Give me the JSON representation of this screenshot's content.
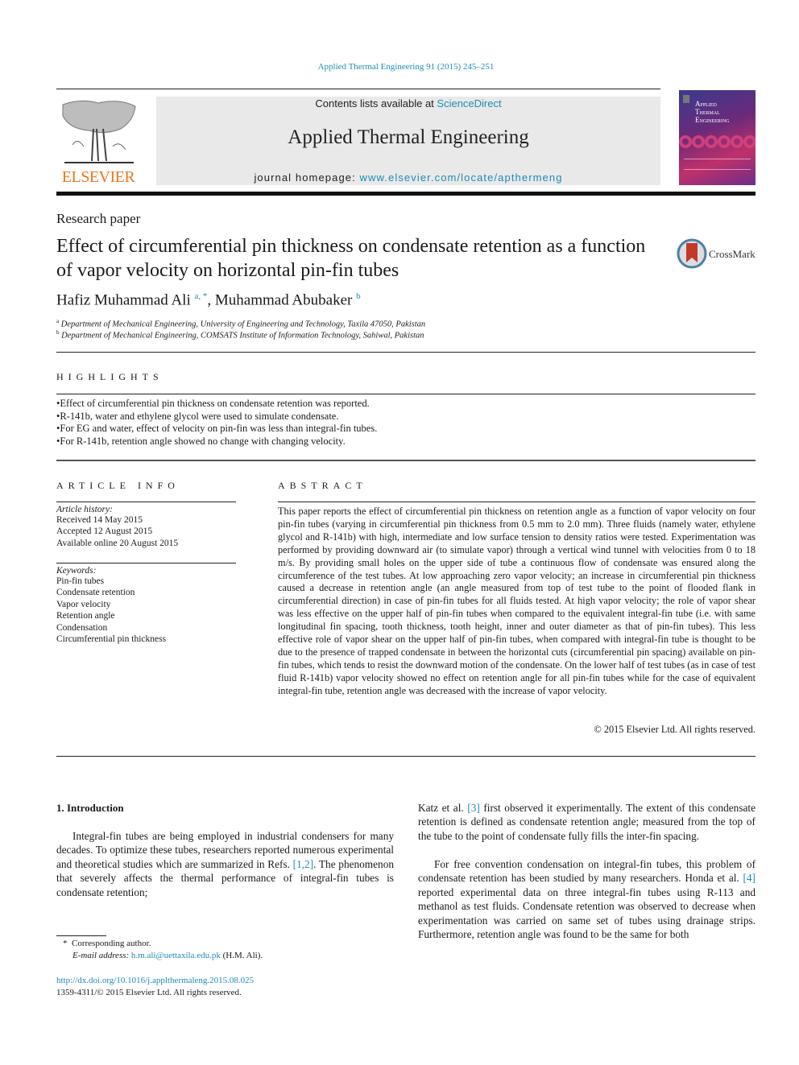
{
  "header": {
    "journal_ref": "Applied Thermal Engineering 91 (2015) 245–251",
    "contents_prefix": "Contents lists available at ",
    "contents_link": "ScienceDirect",
    "journal_title": "Applied Thermal Engineering",
    "homepage_prefix": "journal homepage: ",
    "homepage_link": "www.elsevier.com/locate/apthermeng",
    "publisher_logo_text": "ELSEVIER",
    "cover_title_lines": [
      "Applied",
      "Thermal",
      "Engineering"
    ]
  },
  "article": {
    "type": "Research paper",
    "title": "Effect of circumferential pin thickness on condensate retention as a function of vapor velocity on horizontal pin-fin tubes",
    "crossmark_label": "CrossMark",
    "authors": [
      {
        "name": "Hafiz Muhammad Ali",
        "sup": "a, *"
      },
      {
        "name": "Muhammad Abubaker",
        "sup": "b"
      }
    ],
    "author_separator": ", ",
    "affiliations": [
      {
        "key": "a",
        "text": "Department of Mechanical Engineering, University of Engineering and Technology, Taxila 47050, Pakistan"
      },
      {
        "key": "b",
        "text": "Department of Mechanical Engineering, COMSATS Institute of Information Technology, Sahiwal, Pakistan"
      }
    ]
  },
  "highlights": {
    "heading": "HIGHLIGHTS",
    "items": [
      "Effect of circumferential pin thickness on condensate retention was reported.",
      "R-141b, water and ethylene glycol were used to simulate condensate.",
      "For EG and water, effect of velocity on pin-fin was less than integral-fin tubes.",
      "For R-141b, retention angle showed no change with changing velocity."
    ]
  },
  "article_info": {
    "heading": "ARTICLE INFO",
    "history_label": "Article history:",
    "history": [
      "Received 14 May 2015",
      "Accepted 12 August 2015",
      "Available online 20 August 2015"
    ],
    "keywords_label": "Keywords:",
    "keywords": [
      "Pin-fin tubes",
      "Condensate retention",
      "Vapor velocity",
      "Retention angle",
      "Condensation",
      "Circumferential pin thickness"
    ]
  },
  "abstract": {
    "heading": "ABSTRACT",
    "text": "This paper reports the effect of circumferential pin thickness on retention angle as a function of vapor velocity on four pin-fin tubes (varying in circumferential pin thickness from 0.5 mm to 2.0 mm). Three fluids (namely water, ethylene glycol and R-141b) with high, intermediate and low surface tension to density ratios were tested. Experimentation was performed by providing downward air (to simulate vapor) through a vertical wind tunnel with velocities from 0 to 18 m/s. By providing small holes on the upper side of tube a continuous flow of condensate was ensured along the circumference of the test tubes. At low approaching zero vapor velocity; an increase in circumferential pin thickness caused a decrease in retention angle (an angle measured from top of test tube to the point of flooded flank in circumferential direction) in case of pin-fin tubes for all fluids tested. At high vapor velocity; the role of vapor shear was less effective on the upper half of pin-fin tubes when compared to the equivalent integral-fin tube (i.e. with same longitudinal fin spacing, tooth thickness, tooth height, inner and outer diameter as that of pin-fin tubes). This less effective role of vapor shear on the upper half of pin-fin tubes, when compared with integral-fin tube is thought to be due to the presence of trapped condensate in between the horizontal cuts (circumferential pin spacing) available on pin-fin tubes, which tends to resist the downward motion of the condensate. On the lower half of test tubes (as in case of test fluid R-141b) vapor velocity showed no effect on retention angle for all pin-fin tubes while for the case of equivalent integral-fin tube, retention angle was decreased with the increase of vapor velocity.",
    "copyright": "© 2015 Elsevier Ltd. All rights reserved."
  },
  "introduction": {
    "heading": "1.  Introduction",
    "left_p1_a": "Integral-fin tubes are being employed in industrial condensers for many decades. To optimize these tubes, researchers reported numerous experimental and theoretical studies which are summarized in Refs. ",
    "left_p1_ref": "[1,2]",
    "left_p1_b": ". The phenomenon that severely affects the thermal performance of integral-fin tubes is condensate retention;",
    "right_p1_a": "Katz et al. ",
    "right_p1_ref": "[3]",
    "right_p1_b": " first observed it experimentally. The extent of this condensate retention is defined as condensate retention angle; measured from the top of the tube to the point of condensate fully fills the inter-fin spacing.",
    "right_p2_a": "For free convention condensation on integral-fin tubes, this problem of condensate retention has been studied by many researchers. Honda et al. ",
    "right_p2_ref": "[4]",
    "right_p2_b": " reported experimental data on three integral-fin tubes using R-113 and methanol as test fluids. Condensate retention was observed to decrease when experimentation was carried on same set of tubes using drainage strips. Furthermore, retention angle was found to be the same for both"
  },
  "footnotes": {
    "corresponding_mark": "*",
    "corresponding": "Corresponding author.",
    "email_label": "E-mail address:",
    "email": "h.m.ali@uettaxila.edu.pk",
    "email_suffix": " (H.M. Ali).",
    "doi": "http://dx.doi.org/10.1016/j.applthermaleng.2015.08.025",
    "issn": "1359-4311/© 2015 Elsevier Ltd. All rights reserved."
  }
}
